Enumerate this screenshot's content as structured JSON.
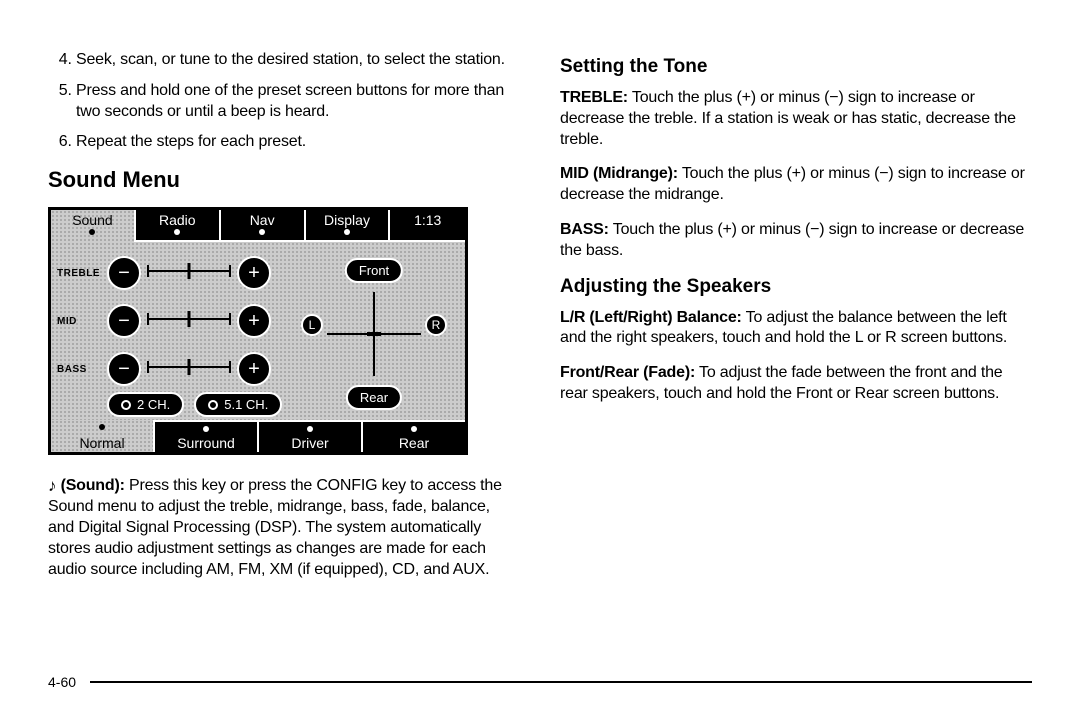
{
  "left": {
    "steps": [
      "Seek, scan, or tune to the desired station, to select the station.",
      "Press and hold one of the preset screen buttons for more than two seconds or until a beep is heard.",
      "Repeat the steps for each preset."
    ],
    "start_num": 4,
    "heading_sound": "Sound Menu",
    "screen": {
      "tabs_top": [
        "Sound",
        "Radio",
        "Nav",
        "Display",
        "1:13"
      ],
      "tone_labels": [
        "TREBLE",
        "MID",
        "BASS"
      ],
      "minus": "−",
      "plus": "+",
      "front": "Front",
      "rear_pill": "Rear",
      "L": "L",
      "R": "R",
      "ch2": "2 CH.",
      "ch51": "5.1 CH.",
      "tabs_bottom": [
        "Normal",
        "Surround",
        "Driver",
        "Rear"
      ]
    },
    "sound_note_icon": "♪",
    "sound_note_bold": "(Sound):",
    "sound_note_text": "Press this key or press the CONFIG key to access the Sound menu to adjust the treble, midrange, bass, fade, balance, and Digital Signal Processing (DSP). The system automatically stores audio adjustment settings as changes are made for each audio source including AM, FM, XM (if equipped), CD, and AUX."
  },
  "right": {
    "heading_tone": "Setting the Tone",
    "treble_bold": "TREBLE:",
    "treble_text": "Touch the plus (+) or minus (−) sign to increase or decrease the treble. If a station is weak or has static, decrease the treble.",
    "mid_bold": "MID (Midrange):",
    "mid_text": "Touch the plus (+) or minus (−) sign to increase or decrease the midrange.",
    "bass_bold": "BASS:",
    "bass_text": "Touch the plus (+) or minus (−) sign to increase or decrease the bass.",
    "heading_speakers": "Adjusting the Speakers",
    "lr_bold": "L/R (Left/Right) Balance:",
    "lr_text": "To adjust the balance between the left and the right speakers, touch and hold the L or R screen buttons.",
    "fr_bold": "Front/Rear (Fade):",
    "fr_text": "To adjust the fade between the front and the rear speakers, touch and hold the Front or Rear screen buttons."
  },
  "page_num": "4-60"
}
